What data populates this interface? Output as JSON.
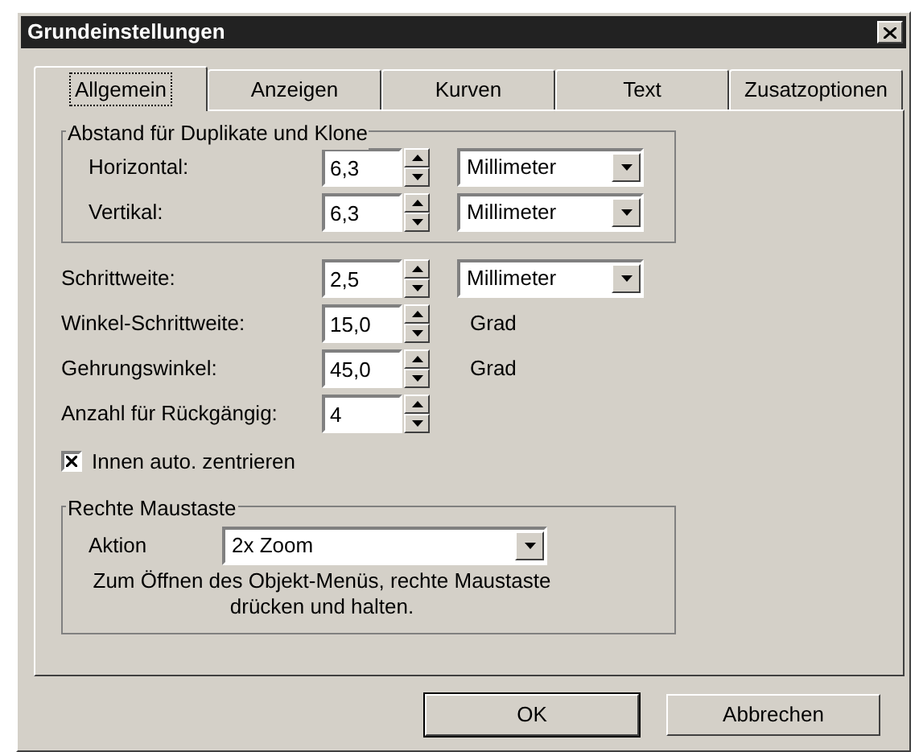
{
  "window": {
    "title": "Grundeinstellungen"
  },
  "tabs": [
    {
      "label": "Allgemein",
      "selected": true
    },
    {
      "label": "Anzeigen",
      "selected": false
    },
    {
      "label": "Kurven",
      "selected": false
    },
    {
      "label": "Text",
      "selected": false
    },
    {
      "label": "Zusatzoptionen",
      "selected": false
    }
  ],
  "duplicate_group": {
    "title": "Abstand für Duplikate und Klone",
    "rows": [
      {
        "label": "Horizontal:",
        "value": "6,3",
        "unit": "Millimeter"
      },
      {
        "label": "Vertikal:",
        "value": "6,3",
        "unit": "Millimeter"
      }
    ]
  },
  "settings": [
    {
      "kind": "dropdown",
      "label": "Schrittweite:",
      "value": "2,5",
      "unit": "Millimeter"
    },
    {
      "kind": "text",
      "label": "Winkel-Schrittweite:",
      "value": "15,0",
      "unit": "Grad"
    },
    {
      "kind": "text",
      "label": "Gehrungswinkel:",
      "value": "45,0",
      "unit": "Grad"
    },
    {
      "kind": "none",
      "label": "Anzahl für Rückgängig:",
      "value": "4"
    }
  ],
  "auto_center": {
    "label": "Innen auto. zentrieren",
    "checked": true
  },
  "right_mouse": {
    "title": "Rechte Maustaste",
    "label": "Aktion",
    "action": "2x Zoom",
    "note": "Zum Öffnen des Objekt-Menüs, rechte Maustaste drücken und halten."
  },
  "buttons": [
    {
      "label": "OK",
      "default": true
    },
    {
      "label": "Abbrechen",
      "default": false
    }
  ]
}
